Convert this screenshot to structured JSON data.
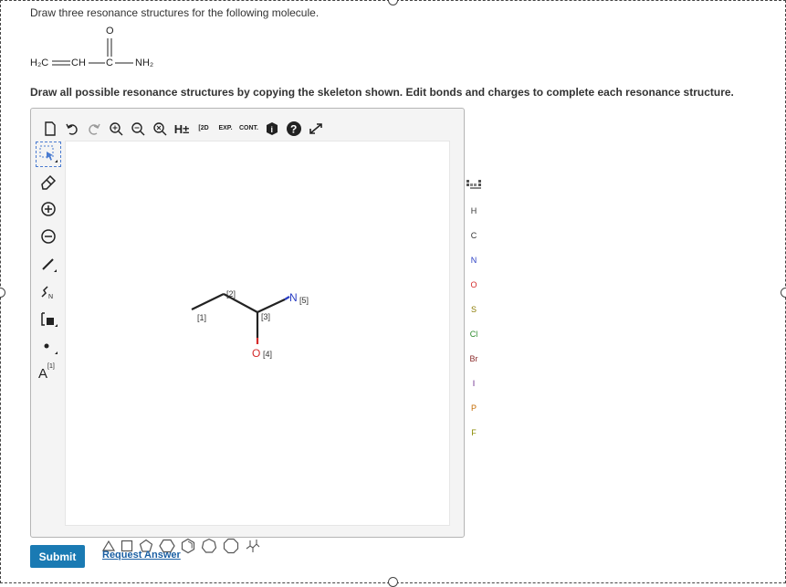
{
  "question": {
    "prompt": "Draw three resonance structures for the following molecule.",
    "instruction": "Draw all possible resonance structures by copying the skeleton shown. Edit bonds and charges to complete each resonance structure."
  },
  "molecule": {
    "h2c": "H₂C",
    "ch": "CH",
    "c": "C",
    "o": "O",
    "nh2": "NH₂"
  },
  "toolbar": {
    "h_label": "H±",
    "twod_label": "[2D",
    "exp_label": "EXP.",
    "cont_label": "CONT."
  },
  "left_tools": {
    "charge_label": "A",
    "charge_index": "[1]"
  },
  "atoms": [
    "H",
    "C",
    "N",
    "O",
    "S",
    "Cl",
    "Br",
    "I",
    "P",
    "F"
  ],
  "atom_colors": {
    "H": "#333",
    "C": "#333",
    "N": "#2a3ec4",
    "O": "#d42a2a",
    "S": "#8a7a00",
    "Cl": "#2a8a2a",
    "Br": "#8a2a2a",
    "I": "#6a2a8a",
    "P": "#c46a00",
    "F": "#8a8a00"
  },
  "skeleton": {
    "n_label": "N",
    "o_label": "O",
    "idx1": "[1]",
    "idx2": "[2]",
    "idx3": "[3]",
    "idx4": "[4]",
    "idx5": "[5]"
  },
  "actions": {
    "submit": "Submit",
    "request": "Request Answer"
  }
}
